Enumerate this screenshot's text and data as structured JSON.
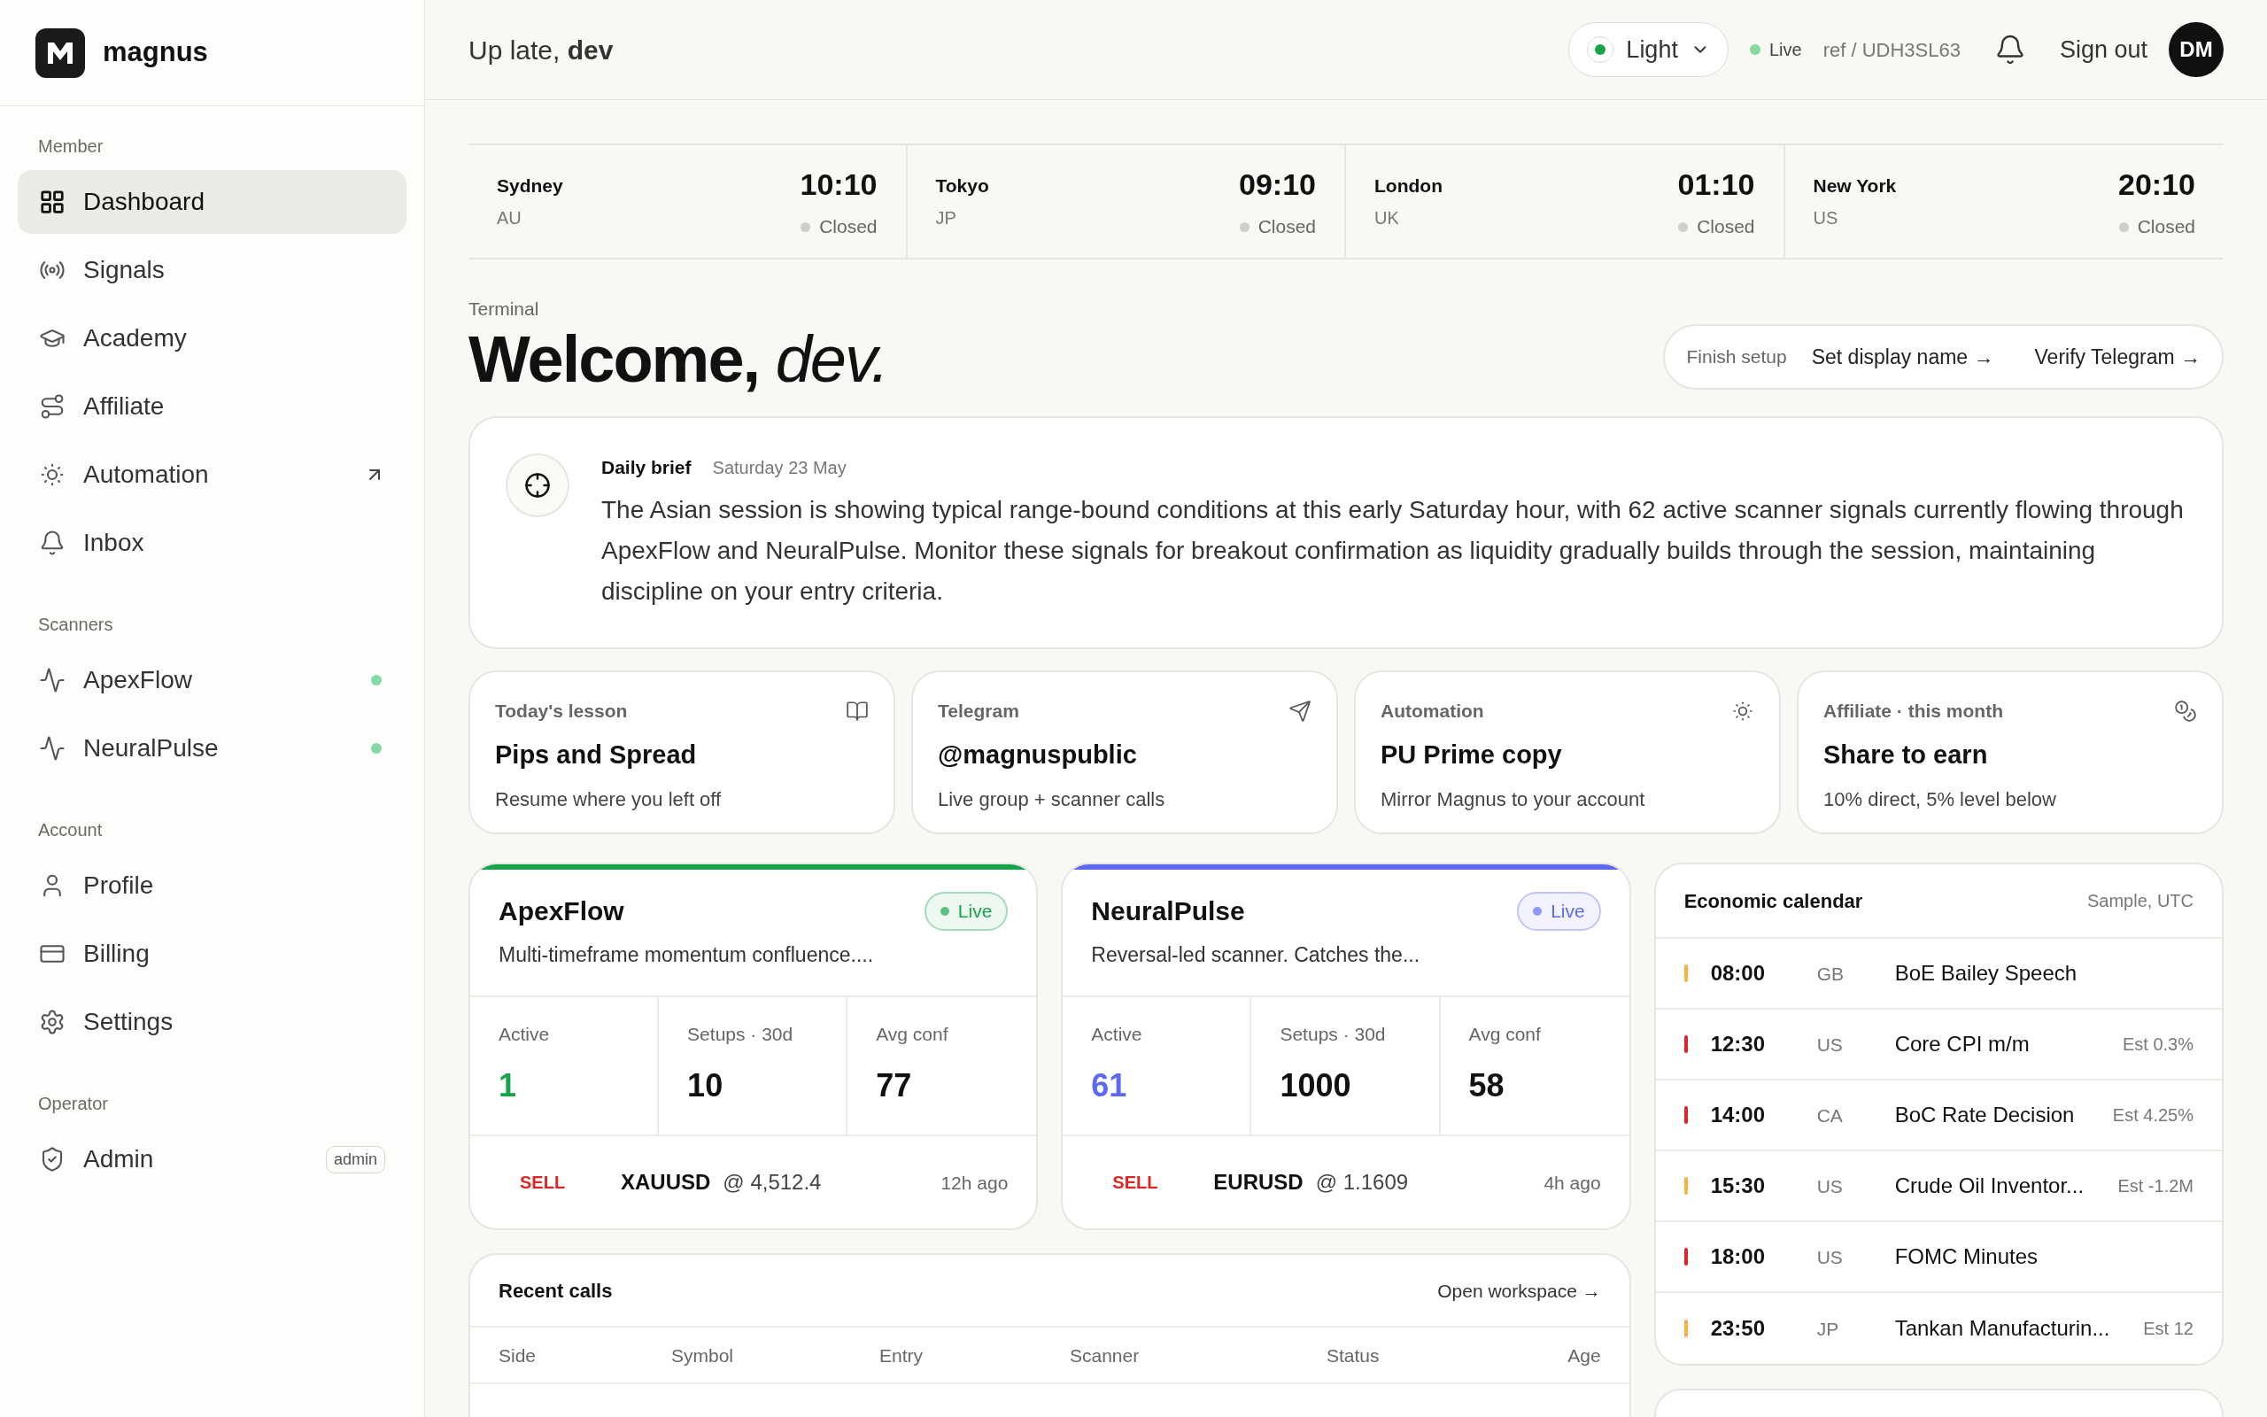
{
  "brand": {
    "name": "magnus"
  },
  "sidebar": {
    "sections": [
      {
        "title": "Member",
        "items": [
          {
            "label": "Dashboard",
            "selected": true
          },
          {
            "label": "Signals",
            "selected": false
          },
          {
            "label": "Academy",
            "selected": false
          },
          {
            "label": "Affiliate",
            "selected": false
          },
          {
            "label": "Automation",
            "selected": false,
            "external": true
          },
          {
            "label": "Inbox",
            "selected": false
          }
        ]
      },
      {
        "title": "Scanners",
        "items": [
          {
            "label": "ApexFlow",
            "selected": false,
            "live": true
          },
          {
            "label": "NeuralPulse",
            "selected": false,
            "live": true
          }
        ]
      },
      {
        "title": "Account",
        "items": [
          {
            "label": "Profile",
            "selected": false
          },
          {
            "label": "Billing",
            "selected": false
          },
          {
            "label": "Settings",
            "selected": false
          }
        ]
      },
      {
        "title": "Operator",
        "items": [
          {
            "label": "Admin",
            "selected": false,
            "badge": "admin"
          }
        ]
      }
    ]
  },
  "header": {
    "greeting": "Up late, **dev**",
    "theme": {
      "value": "Light"
    },
    "live": "Live",
    "ref": "ref / UDH3SL63",
    "sign_out": "Sign out",
    "avatar": "DM"
  },
  "clocks": [
    {
      "city": "Sydney",
      "country": "AU",
      "time": "10:10",
      "status": "Closed",
      "open": false
    },
    {
      "city": "Tokyo",
      "country": "JP",
      "time": "09:10",
      "status": "Closed",
      "open": false
    },
    {
      "city": "London",
      "country": "UK",
      "time": "01:10",
      "status": "Closed",
      "open": false
    },
    {
      "city": "New York",
      "country": "US",
      "time": "20:10",
      "status": "Closed",
      "open": false
    }
  ],
  "welcome": {
    "eyebrow": "Terminal",
    "title": "Welcome, *dev.*"
  },
  "setup": {
    "label": "Finish setup",
    "links": [
      "Set display name →",
      "Verify Telegram →"
    ]
  },
  "brief": {
    "title": "Daily brief",
    "date": "Saturday 23 May",
    "text": "The Asian session is showing typical range-bound conditions at this early Saturday hour, with 62 active scanner signals currently flowing through ApexFlow and NeuralPulse. Monitor these signals for breakout confirmation as liquidity gradually builds through the session, maintaining discipline on your entry criteria."
  },
  "quick_cards": [
    {
      "eyebrow": "Today's lesson",
      "title": "Pips and Spread",
      "subtitle": "Resume where you left off"
    },
    {
      "eyebrow": "Telegram",
      "title": "@magnuspublic",
      "subtitle": "Live group + scanner calls"
    },
    {
      "eyebrow": "Automation",
      "title": "PU Prime copy",
      "subtitle": "Mirror Magnus to your account"
    },
    {
      "eyebrow": "Affiliate · this month",
      "title": "Share to earn",
      "subtitle": "10% direct, 5% level below"
    }
  ],
  "scanners": [
    {
      "name": "ApexFlow",
      "color": "#16a34a",
      "status": "Live",
      "description": "Multi-timeframe momentum confluence....",
      "stats": [
        {
          "label": "Active",
          "value": "1"
        },
        {
          "label": "Setups · 30d",
          "value": "10"
        },
        {
          "label": "Avg conf",
          "value": "77"
        }
      ],
      "last_call": {
        "side": "SELL",
        "symbol": "XAUUSD",
        "price": "@ 4,512.4",
        "age": "12h ago"
      }
    },
    {
      "name": "NeuralPulse",
      "color": "#5b6af0",
      "status": "Live",
      "description": "Reversal-led scanner. Catches the...",
      "stats": [
        {
          "label": "Active",
          "value": "61"
        },
        {
          "label": "Setups · 30d",
          "value": "1000"
        },
        {
          "label": "Avg conf",
          "value": "58"
        }
      ],
      "last_call": {
        "side": "SELL",
        "symbol": "EURUSD",
        "price": "@ 1.1609",
        "age": "4h ago"
      }
    }
  ],
  "calendar": {
    "title": "Economic calendar",
    "note": "Sample, UTC",
    "events": [
      {
        "color": "#f5b04a",
        "time": "08:00",
        "country": "GB",
        "name": "BoE Bailey Speech"
      },
      {
        "color": "#dc2626",
        "time": "12:30",
        "country": "US",
        "name": "Core CPI m/m",
        "estimate": "Est 0.3%"
      },
      {
        "color": "#dc2626",
        "time": "14:00",
        "country": "CA",
        "name": "BoC Rate Decision",
        "estimate": "Est 4.25%"
      },
      {
        "color": "#f5b04a",
        "time": "15:30",
        "country": "US",
        "name": "Crude Oil Inventor...",
        "estimate": "Est -1.2M"
      },
      {
        "color": "#dc2626",
        "time": "18:00",
        "country": "US",
        "name": "FOMC Minutes"
      },
      {
        "color": "#f5b04a",
        "time": "23:50",
        "country": "JP",
        "name": "Tankan Manufacturin...",
        "estimate": "Est 12"
      }
    ]
  },
  "recent_calls": {
    "title": "Recent calls",
    "link": "Open workspace →",
    "columns": [
      "Side",
      "Symbol",
      "Entry",
      "Scanner",
      "Status",
      "Age"
    ]
  }
}
